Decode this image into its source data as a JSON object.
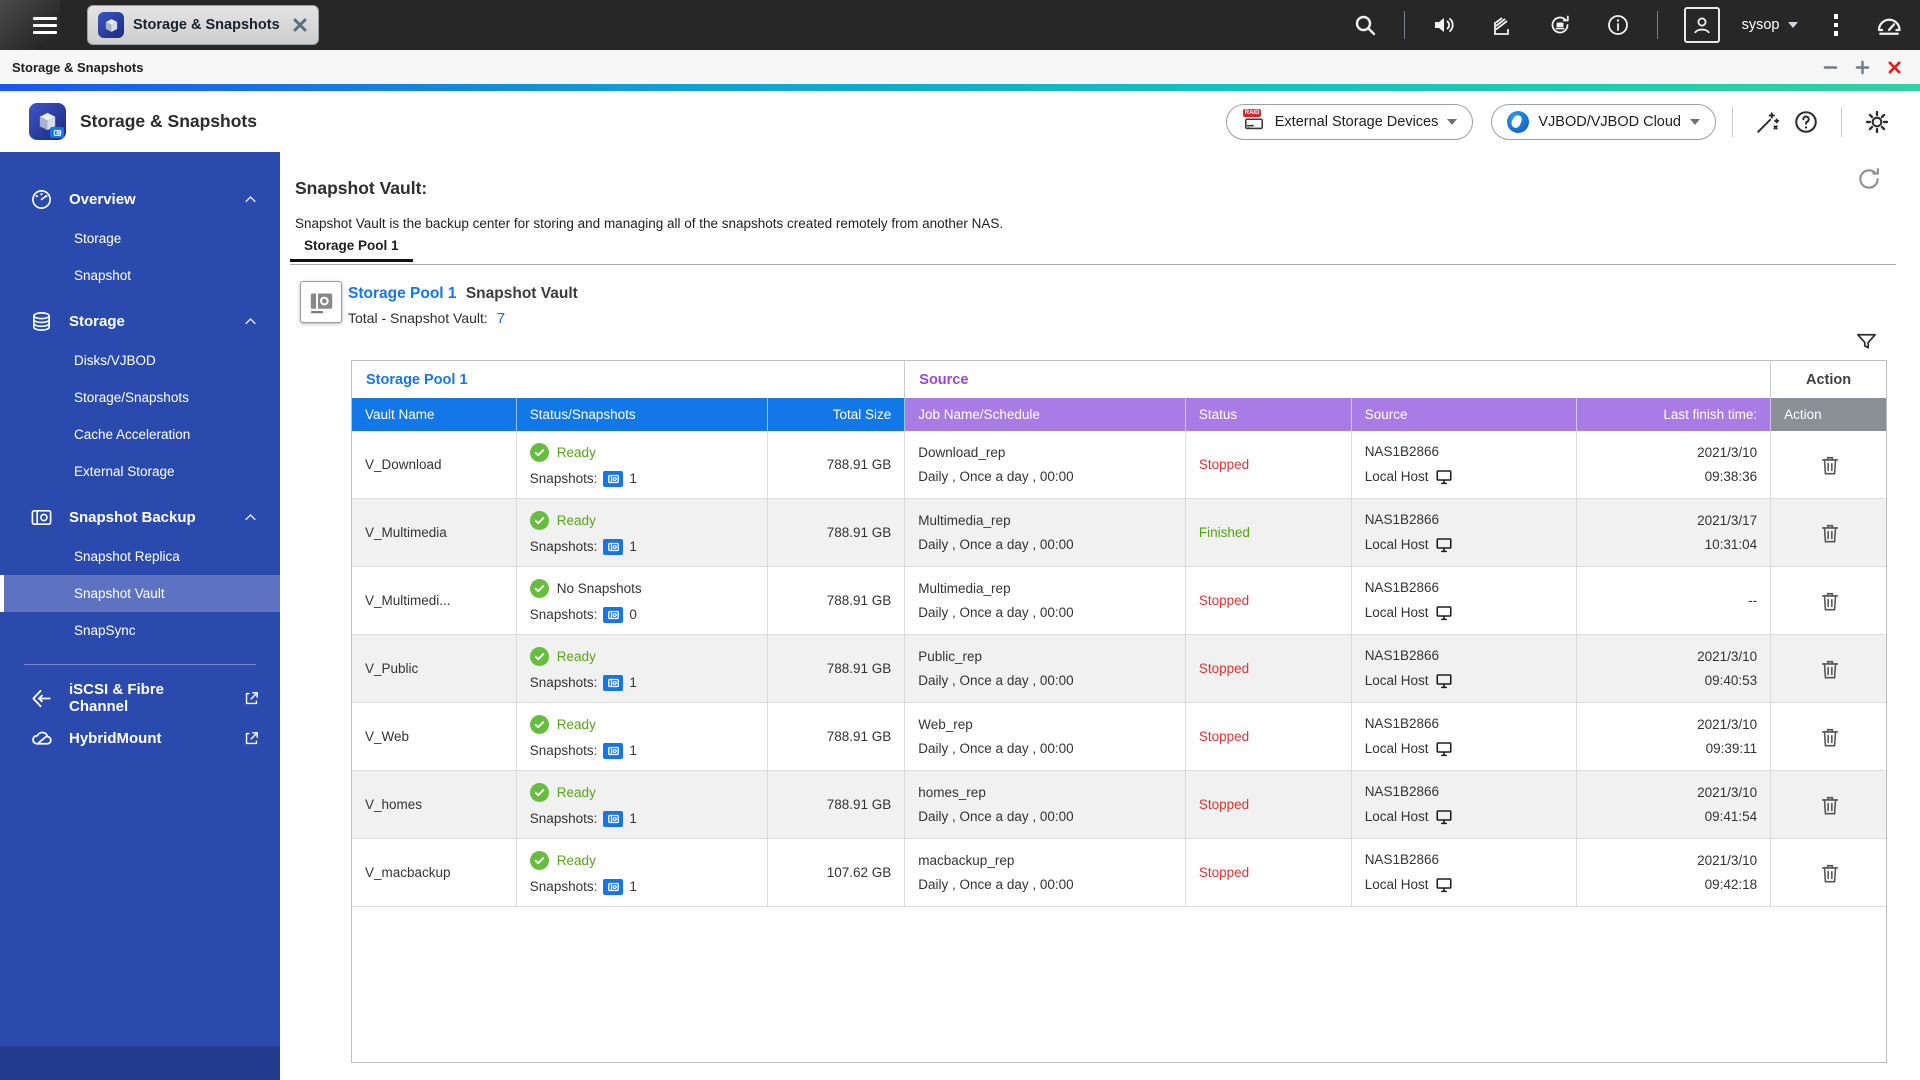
{
  "topbar": {
    "tab_title": "Storage & Snapshots",
    "user": "sysop"
  },
  "titlebar": {
    "title": "Storage & Snapshots"
  },
  "header": {
    "title": "Storage & Snapshots",
    "devices_button": "External Storage Devices",
    "vjbod_button": "VJBOD/VJBOD Cloud"
  },
  "sidebar": {
    "groups": [
      {
        "label": "Overview",
        "icon": "gauge-icon",
        "items": [
          "Storage",
          "Snapshot"
        ]
      },
      {
        "label": "Storage",
        "icon": "disks-icon",
        "items": [
          "Disks/VJBOD",
          "Storage/Snapshots",
          "Cache Acceleration",
          "External Storage"
        ]
      },
      {
        "label": "Snapshot Backup",
        "icon": "camera-icon",
        "items": [
          "Snapshot Replica",
          "Snapshot Vault",
          "SnapSync"
        ],
        "selected_item": "Snapshot Vault"
      }
    ],
    "links": [
      {
        "label": "iSCSI & Fibre Channel",
        "icon": "iscsi-icon"
      },
      {
        "label": "HybridMount",
        "icon": "cloud-icon"
      }
    ]
  },
  "content": {
    "page_title": "Snapshot Vault:",
    "description": "Snapshot Vault is the backup center for storing and managing all of the snapshots created remotely from another NAS.",
    "tab": "Storage Pool 1",
    "section": {
      "pool": "Storage Pool 1",
      "suffix": "Snapshot Vault",
      "total_label": "Total - Snapshot Vault:",
      "total_value": "7"
    }
  },
  "table": {
    "groups": [
      "Storage Pool 1",
      "Source",
      "Action"
    ],
    "columns": [
      "Vault Name",
      "Status/Snapshots",
      "Total Size",
      "Job Name/Schedule",
      "Status",
      "Source",
      "Last finish time:",
      "Action"
    ],
    "snapshots_label": "Snapshots:",
    "rows": [
      {
        "vault_name": "V_Download",
        "status_text": "Ready",
        "snap_count": "1",
        "total_size": "788.91 GB",
        "job_name": "Download_rep",
        "job_schedule": "Daily , Once a day , 00:00",
        "job_status": "Stopped",
        "source_name": "NAS1B2866",
        "source_host": "Local Host",
        "finish_date": "2021/3/10",
        "finish_time": "09:38:36"
      },
      {
        "vault_name": "V_Multimedia",
        "status_text": "Ready",
        "snap_count": "1",
        "total_size": "788.91 GB",
        "job_name": "Multimedia_rep",
        "job_schedule": "Daily , Once a day , 00:00",
        "job_status": "Finished",
        "source_name": "NAS1B2866",
        "source_host": "Local Host",
        "finish_date": "2021/3/17",
        "finish_time": "10:31:04"
      },
      {
        "vault_name": "V_Multimedi...",
        "status_text": "No Snapshots",
        "snap_count": "0",
        "total_size": "788.91 GB",
        "job_name": "Multimedia_rep",
        "job_schedule": "Daily , Once a day , 00:00",
        "job_status": "Stopped",
        "source_name": "NAS1B2866",
        "source_host": "Local Host",
        "finish_date": "--",
        "finish_time": ""
      },
      {
        "vault_name": "V_Public",
        "status_text": "Ready",
        "snap_count": "1",
        "total_size": "788.91 GB",
        "job_name": "Public_rep",
        "job_schedule": "Daily , Once a day , 00:00",
        "job_status": "Stopped",
        "source_name": "NAS1B2866",
        "source_host": "Local Host",
        "finish_date": "2021/3/10",
        "finish_time": "09:40:53"
      },
      {
        "vault_name": "V_Web",
        "status_text": "Ready",
        "snap_count": "1",
        "total_size": "788.91 GB",
        "job_name": "Web_rep",
        "job_schedule": "Daily , Once a day , 00:00",
        "job_status": "Stopped",
        "source_name": "NAS1B2866",
        "source_host": "Local Host",
        "finish_date": "2021/3/10",
        "finish_time": "09:39:11"
      },
      {
        "vault_name": "V_homes",
        "status_text": "Ready",
        "snap_count": "1",
        "total_size": "788.91 GB",
        "job_name": "homes_rep",
        "job_schedule": "Daily , Once a day , 00:00",
        "job_status": "Stopped",
        "source_name": "NAS1B2866",
        "source_host": "Local Host",
        "finish_date": "2021/3/10",
        "finish_time": "09:41:54"
      },
      {
        "vault_name": "V_macbackup",
        "status_text": "Ready",
        "snap_count": "1",
        "total_size": "107.62 GB",
        "job_name": "macbackup_rep",
        "job_schedule": "Daily , Once a day , 00:00",
        "job_status": "Stopped",
        "source_name": "NAS1B2866",
        "source_host": "Local Host",
        "finish_date": "2021/3/10",
        "finish_time": "09:42:18"
      }
    ]
  },
  "colors": {
    "sidebar_blue": "#2b4aad",
    "sidebar_selected": "#5d73c2",
    "header_blue": "#1278e8",
    "header_purple": "#a87ce4",
    "header_gray": "#8a9096",
    "link_blue": "#1576e8",
    "status_green": "#55a617",
    "status_red": "#e23230",
    "gradient_left": "#1a57f2",
    "gradient_right": "#2fd3a0"
  }
}
